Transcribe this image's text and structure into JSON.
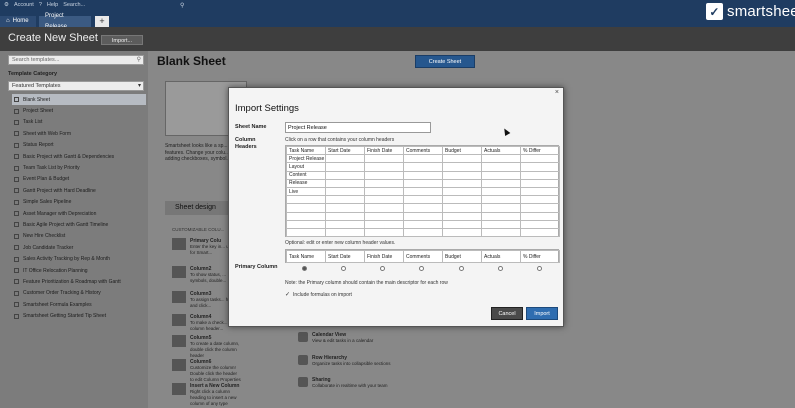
{
  "topbar": {
    "account": "Account",
    "help": "Help",
    "search": "Search...",
    "logo": "smartsheet",
    "tabs": [
      {
        "label": "Home"
      },
      {
        "label": "Project Release"
      },
      {
        "label": "+"
      }
    ]
  },
  "header": {
    "title": "Create New Sheet",
    "import_label": "Import..."
  },
  "sidebar": {
    "search_placeholder": "Search templates...",
    "category_label": "Template Category",
    "category_value": "Featured Templates",
    "items": [
      {
        "label": "Blank Sheet"
      },
      {
        "label": "Project Sheet"
      },
      {
        "label": "Task List"
      },
      {
        "label": "Sheet with Web Form"
      },
      {
        "label": "Status Report"
      },
      {
        "label": "Basic Project with Gantt & Dependencies"
      },
      {
        "label": "Team Task List by Priority"
      },
      {
        "label": "Event Plan & Budget"
      },
      {
        "label": "Gantt Project with Hard Deadline"
      },
      {
        "label": "Simple Sales Pipeline"
      },
      {
        "label": "Asset Manager with Depreciation"
      },
      {
        "label": "Basic Agile Project with Gantt Timeline"
      },
      {
        "label": "New Hire Checklist"
      },
      {
        "label": "Job Candidate Tracker"
      },
      {
        "label": "Sales Activity Tracking by Rep & Month"
      },
      {
        "label": "IT Office Relocation Planning"
      },
      {
        "label": "Feature Prioritization & Roadmap with Gantt"
      },
      {
        "label": "Customer Order Tracking & History"
      },
      {
        "label": "Smartsheet Formula Examples"
      },
      {
        "label": "Smartsheet Getting Started Tip Sheet"
      }
    ]
  },
  "main": {
    "title": "Blank Sheet",
    "create_label": "Create Sheet",
    "desc": "Smartsheet looks like a sp... features. Change your colu... adding checkboxes, symbol...",
    "sheet_design": "Sheet design",
    "custom_col": "CUSTOMIZABLE COLU...",
    "features": [
      {
        "title": "Primary Colu",
        "text": "Enter the key in... used for Smart..."
      },
      {
        "title": "Column2",
        "text": "To show status, ... symbols, double..."
      },
      {
        "title": "Column3",
        "text": "To assign tasks... header and click..."
      },
      {
        "title": "Column4",
        "text": "To make a check... the column header..."
      },
      {
        "title": "Column5",
        "text": "To create a date column, double click the column header"
      },
      {
        "title": "Column6",
        "text": "Customize the column! Double click the header to edit Column Properties"
      },
      {
        "title": "Insert a New Column",
        "text": "Right click a column heading to insert a new column of any type"
      }
    ],
    "right_features": [
      {
        "title": "Calendar View",
        "text": "View & edit tasks in a calendar"
      },
      {
        "title": "Row Hierarchy",
        "text": "Organize tasks into collapsible sections"
      },
      {
        "title": "Sharing",
        "text": "Collaborate in realtime with your team"
      }
    ]
  },
  "dialog": {
    "title": "Import Settings",
    "close": "×",
    "sheet_name_label": "Sheet Name",
    "sheet_name_value": "Project Release",
    "hint_columns": "Click on a row that contains your column headers",
    "column_headers_label": "Column Headers",
    "grid_columns": [
      "Task Name",
      "Start Date",
      "Finish Date",
      "Comments",
      "Budget",
      "Actuals",
      "% Differ"
    ],
    "grid_rows": [
      [
        "Project Release",
        "",
        "",
        "",
        "",
        "",
        ""
      ],
      [
        "Layout",
        "",
        "",
        "",
        "",
        "",
        ""
      ],
      [
        "Content",
        "",
        "",
        "",
        "",
        "",
        ""
      ],
      [
        "Release",
        "",
        "",
        "",
        "",
        "",
        ""
      ],
      [
        "Live",
        "",
        "",
        "",
        "",
        "",
        ""
      ],
      [
        "",
        "",
        "",
        "",
        "",
        "",
        ""
      ],
      [
        "",
        "",
        "",
        "",
        "",
        "",
        ""
      ],
      [
        "",
        "",
        "",
        "",
        "",
        "",
        ""
      ],
      [
        "",
        "",
        "",
        "",
        "",
        "",
        ""
      ],
      [
        "",
        "",
        "",
        "",
        "",
        "",
        ""
      ]
    ],
    "hint_edit": "Optional: edit or enter new column header values.",
    "header_values": [
      "Task Name",
      "Start Date",
      "Finish Date",
      "Comments",
      "Budget",
      "Actuals",
      "% Differ"
    ],
    "primary_column_label": "Primary Column",
    "primary_selected_index": 0,
    "note": "Note: the Primary column should contain the main descriptor for each row",
    "include_formulas": "Include formulas on import",
    "include_formulas_checked": true,
    "cancel_label": "Cancel",
    "import_label": "Import"
  }
}
